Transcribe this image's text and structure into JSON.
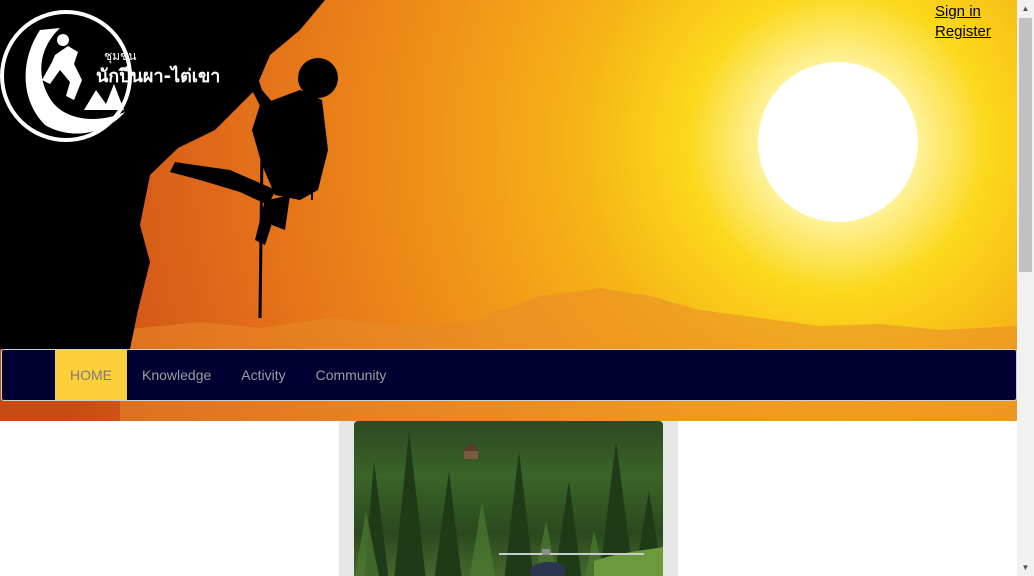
{
  "auth": {
    "sign_in": "Sign in",
    "register": "Register"
  },
  "logo": {
    "text_top": "ชุมชน",
    "text_main": "นักปีนผา-ไต่เขา"
  },
  "nav": {
    "items": [
      {
        "label": "HOME",
        "active": true
      },
      {
        "label": "Knowledge",
        "active": false
      },
      {
        "label": "Activity",
        "active": false
      },
      {
        "label": "Community",
        "active": false
      }
    ],
    "background_color": "#000033",
    "active_color": "#fccf3b"
  },
  "banner": {
    "theme": "sunset rock climber silhouette",
    "sun_color": "#ffffff",
    "sky_colors": [
      "#fbd81a",
      "#ef8f18",
      "#c84a14"
    ]
  },
  "featured_image": {
    "subject": "forest with helicopter"
  },
  "icons": {
    "scroll_up": "triangle-up-icon",
    "scroll_down": "triangle-down-icon"
  }
}
